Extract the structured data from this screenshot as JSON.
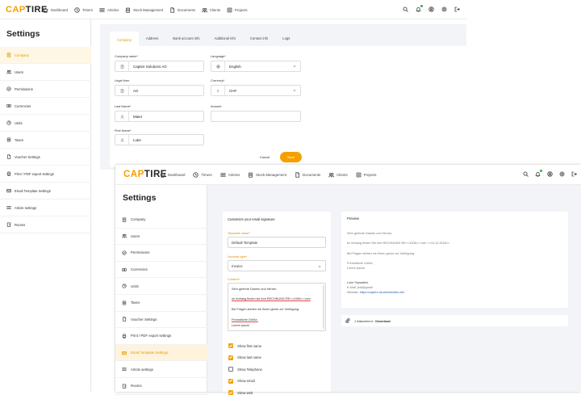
{
  "brand": {
    "part1": "CAP",
    "part2": "TIRE",
    "accent": "#f5a000"
  },
  "nav": [
    {
      "label": "Dashboard",
      "icon": "home-icon"
    },
    {
      "label": "Timers",
      "icon": "clock-icon"
    },
    {
      "label": "Articles",
      "icon": "list-icon"
    },
    {
      "label": "Stock Management",
      "icon": "clipboard-icon"
    },
    {
      "label": "Documents",
      "icon": "document-icon"
    },
    {
      "label": "Clients",
      "icon": "users-icon"
    },
    {
      "label": "Projects",
      "icon": "folder-icon"
    }
  ],
  "settings_title": "Settings",
  "back_window": {
    "sidebar": [
      "Company",
      "Users",
      "Permissions",
      "Currencies",
      "Units",
      "Taxes",
      "Voucher Settings",
      "Print / PDF export settings",
      "Email Template Settings",
      "Article settings",
      "Rooms"
    ],
    "active_index": 0,
    "tabs": [
      "Company",
      "Address",
      "Bank account info",
      "Additional info",
      "Contact info",
      "Logs"
    ],
    "active_tab": 0,
    "form": {
      "company_name_label": "Company name*",
      "company_name_value": "Captire Solutions AG",
      "language_label": "Language*",
      "language_value": "English",
      "legal_form_label": "Legal form",
      "legal_form_value": "AG",
      "currency_label": "Currency*",
      "currency_value": "CHF",
      "currency_prefix": "$",
      "last_name_label": "Last Name*",
      "last_name_value": "Maier",
      "amount_label": "Amount",
      "amount_value": "",
      "first_name_label": "First Name*",
      "first_name_value": "Luke"
    },
    "cancel_label": "Cancel",
    "save_label": "Save"
  },
  "front_window": {
    "sidebar": [
      "Company",
      "Users",
      "Permissions",
      "Currencies",
      "Units",
      "Taxes",
      "Voucher Settings",
      "Print / PDF export settings",
      "Email Template Settings",
      "Article settings",
      "Rooms"
    ],
    "active_index": 8,
    "signature": {
      "title": "Customize your email signature",
      "template_name_label": "Template name*",
      "template_name_value": "Default Template",
      "voucher_type_label": "Voucher type*",
      "voucher_type_value": "Invoice",
      "content_label": "Content*",
      "content_lines": [
        "Sehr geehrte Damen und Herren,",
        "Im Anhang finden sie ihre RECHNUNG RE<<1006>> vom",
        "Bei Fragen stehen wir Ihnen gerne zur Verfügung.",
        "Freundliche Grüße,",
        "Lorem ipsum"
      ],
      "checkboxes": [
        {
          "label": "Show first name",
          "checked": true
        },
        {
          "label": "Show last name",
          "checked": true
        },
        {
          "label": "Show Telephone",
          "checked": false
        },
        {
          "label": "Show email",
          "checked": true
        },
        {
          "label": "Show web",
          "checked": true
        }
      ]
    },
    "preview": {
      "title": "Preview",
      "line1": "Sehr geehrte Damen und Herren,",
      "line2": "Im Anhang finden Sie ihre RECHNUNG RE<<1006>> vom <<14.12.2018>>",
      "line3": "Bei Fragen stehen wir Ihnen gerne zur Verfügung.",
      "line4": "Freundliche Grüße,",
      "line5": "Lorem ipsum",
      "sig_name": "Luke Skywalker",
      "sig_email": "E-Mail: jedi@gmail",
      "sig_web_label": "Website:",
      "sig_web_url": "https://captire.azurewebsites.net/"
    },
    "attachment": {
      "count_text": "1 Attachment -",
      "download_label": "Download"
    }
  }
}
